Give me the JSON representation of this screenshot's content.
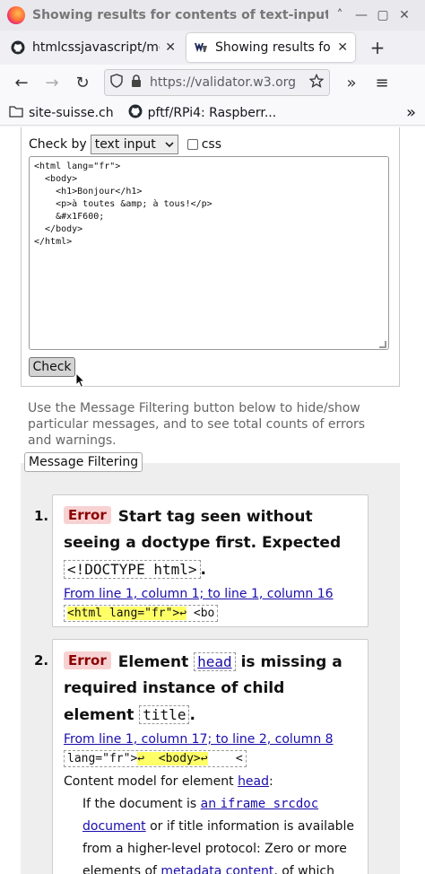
{
  "window": {
    "title": "Showing results for contents of text-input area - Nu Html Checker — Mozilla Firefox",
    "controls": [
      "˄",
      "—",
      "▢",
      "✕"
    ]
  },
  "tabs": [
    {
      "label": "htmlcssjavascript/md/",
      "icon": "github-icon",
      "active": false
    },
    {
      "label": "Showing results for co",
      "icon": "w3c-icon",
      "active": true
    }
  ],
  "new_tab": "+",
  "nav": {
    "back": "←",
    "forward": "→",
    "reload": "↻",
    "url": "https://validator.w3.org",
    "overflow": "»",
    "menu": "≡"
  },
  "bookmarks": [
    {
      "label": "site-suisse.ch",
      "icon": "folder-icon"
    },
    {
      "label": "pftf/RPi4: Raspberr...",
      "icon": "github-icon"
    }
  ],
  "bookmarks_overflow": "»",
  "form": {
    "check_by_label": "Check by",
    "select_value": "text input",
    "css_label": "css",
    "textarea_value": "<html lang=\"fr\">\n  <body>\n    <h1>Bonjour</h1>\n    <p>à toutes &amp; à tous!</p>\n    &#x1F600;\n  </body>\n</html>",
    "check_button": "Check"
  },
  "filter_note": "Use the Message Filtering button below to hide/show particular messages, and to see total counts of errors and warnings.",
  "message_filtering_button": "Message Filtering",
  "messages": [
    {
      "num": "1.",
      "badge": "Error",
      "text_a": "Start tag seen without seeing a doctype first. Expected",
      "code": "<!DOCTYPE html>",
      "text_b": ".",
      "location": "From line 1, column 1; to line 1, column 16",
      "extract_hl": "<html lang=\"fr\">↩",
      "extract_after": " <bo"
    },
    {
      "num": "2.",
      "badge": "Error",
      "text_a": "Element",
      "code_link": "head",
      "text_b": "is missing a required instance of child element",
      "code": "title",
      "text_c": ".",
      "location": "From line 1, column 17; to line 2, column 8",
      "extract_before": "lang=\"fr\">",
      "extract_hl": "↩  <body>↩",
      "extract_after": "    <",
      "content_model_label": "Content model for element",
      "content_model_link": "head",
      "content_model_colon": ":",
      "desc_a": "If the document is",
      "desc_link_a": "an",
      "desc_link_code": "iframe srcdoc",
      "desc_link_b": "document",
      "desc_b": "or if title information is available from a higher-level protocol: Zero or more",
      "desc_c": "elements of",
      "desc_link_c": "metadata content",
      "desc_d": ", of which"
    }
  ]
}
